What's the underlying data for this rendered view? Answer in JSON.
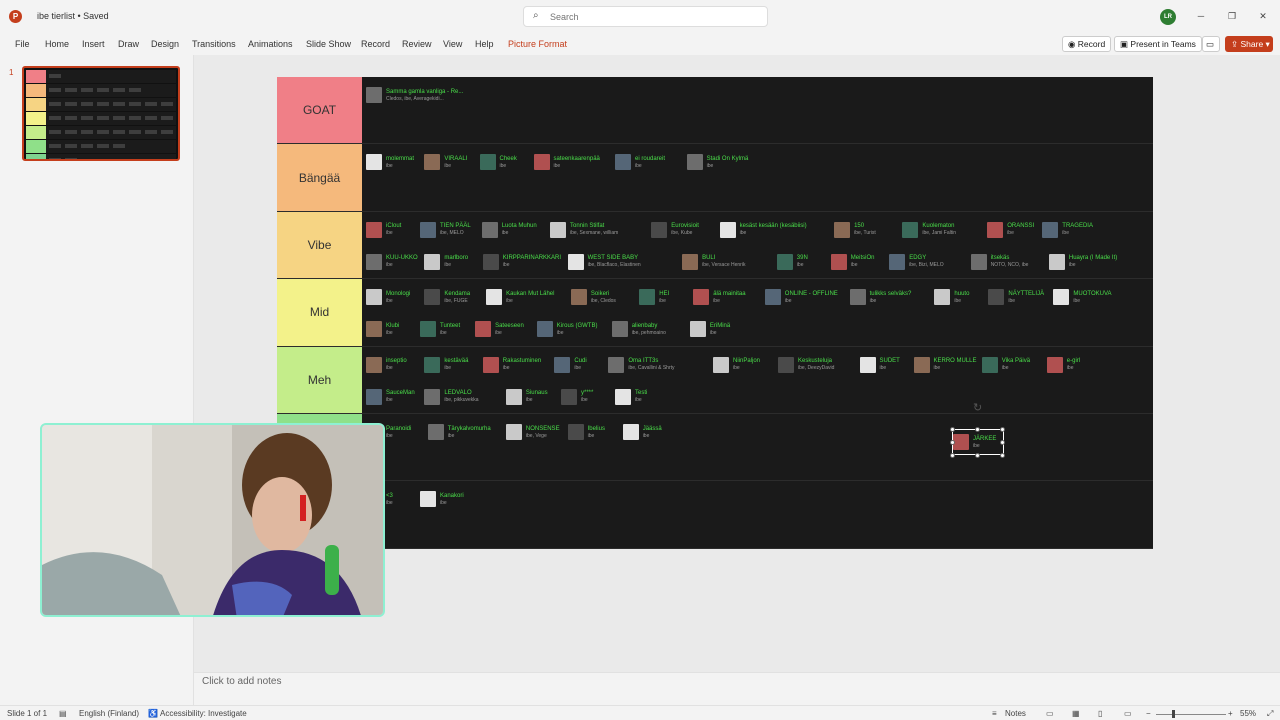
{
  "app": {
    "doc_title": "ibe tierlist • Saved",
    "logo": "P"
  },
  "search": {
    "placeholder": "Search"
  },
  "user": {
    "initials": "LR"
  },
  "menu": {
    "items": [
      "File",
      "Home",
      "Insert",
      "Draw",
      "Design",
      "Transitions",
      "Animations",
      "Slide Show",
      "Record",
      "Review",
      "View",
      "Help",
      "Picture Format"
    ]
  },
  "ribbon": {
    "record_label": "Record",
    "teams_label": "Present in Teams",
    "share_label": "Share"
  },
  "thumbnails": {
    "slide_number": "1"
  },
  "tierlist": {
    "tiers": [
      {
        "label": "GOAT",
        "color": "#f07f87",
        "items": [
          {
            "title": "Samma gamla vanliga - Re...",
            "artist": "Cledos, ibe, Averagekidi..."
          }
        ]
      },
      {
        "label": "Bängää",
        "color": "#f5b97c",
        "items": [
          {
            "title": "molemmat",
            "artist": "ibe"
          },
          {
            "title": "VIRAALI",
            "artist": "ibe"
          },
          {
            "title": "Cheek",
            "artist": "ibe"
          },
          {
            "title": "sateenkaarenpää",
            "artist": "ibe"
          },
          {
            "title": "ei roudareit",
            "artist": "ibe"
          },
          {
            "title": "Stadi On Kylmä",
            "artist": "ibe"
          }
        ]
      },
      {
        "label": "Vibe",
        "color": "#f6d483",
        "items": [
          {
            "title": "iClout",
            "artist": "ibe"
          },
          {
            "title": "TIEN PÄÄL",
            "artist": "ibe, MELO"
          },
          {
            "title": "Luota Muhun",
            "artist": "ibe"
          },
          {
            "title": "Tonnin Stilfat",
            "artist": "ibe, Sexmane, william"
          },
          {
            "title": "Eurovisioit",
            "artist": "ibe, Kube"
          },
          {
            "title": "kesäst kesään (kesäbiisi)",
            "artist": "ibe"
          },
          {
            "title": "150",
            "artist": "ibe, Turist"
          },
          {
            "title": "Kuolematon",
            "artist": "ibe, Jami Faltin"
          },
          {
            "title": "ORANSSI",
            "artist": "ibe"
          },
          {
            "title": "TRAGEDIA",
            "artist": "ibe"
          },
          {
            "title": "KUU-UKKO",
            "artist": "ibe"
          },
          {
            "title": "marlboro",
            "artist": "ibe"
          },
          {
            "title": "KIRPPARINARKKARI",
            "artist": "ibe"
          },
          {
            "title": "WEST SIDE BABY",
            "artist": "ibe, Blacflaco, Elastinen"
          },
          {
            "title": "BULI",
            "artist": "ibe, Versace Henrik"
          },
          {
            "title": "39N",
            "artist": "ibe"
          },
          {
            "title": "MeitsiOn",
            "artist": "ibe"
          },
          {
            "title": "EDGY",
            "artist": "ibe, Bizi, MELO"
          },
          {
            "title": "itsekäs",
            "artist": "NOTO, NCO, ibe"
          },
          {
            "title": "Huayra (I Made It)",
            "artist": "ibe"
          }
        ]
      },
      {
        "label": "Mid",
        "color": "#f3f28a",
        "items": [
          {
            "title": "Monologi",
            "artist": "ibe"
          },
          {
            "title": "Kendama",
            "artist": "ibe, FUGE"
          },
          {
            "title": "Kaukan Mut Lähel",
            "artist": "ibe"
          },
          {
            "title": "Soikeri",
            "artist": "ibe, Cledos"
          },
          {
            "title": "HEI",
            "artist": "ibe"
          },
          {
            "title": "älä mainitaa",
            "artist": "ibe"
          },
          {
            "title": "ONLINE - OFFLINE",
            "artist": "ibe"
          },
          {
            "title": "tulikks selväks?",
            "artist": "ibe"
          },
          {
            "title": "huuto",
            "artist": "ibe"
          },
          {
            "title": "NÄYTTELIJÄ",
            "artist": "ibe"
          },
          {
            "title": "MUOTOKUVA",
            "artist": "ibe"
          },
          {
            "title": "Klubi",
            "artist": "ibe"
          },
          {
            "title": "Tunteet",
            "artist": "ibe"
          },
          {
            "title": "Sateeseen",
            "artist": "ibe"
          },
          {
            "title": "Kirous (GWTB)",
            "artist": "ibe"
          },
          {
            "title": "alienbaby",
            "artist": "ibe, pehmoaino"
          },
          {
            "title": "EriMinä",
            "artist": "ibe"
          }
        ]
      },
      {
        "label": "Meh",
        "color": "#c4ed8a",
        "items": [
          {
            "title": "inseptio",
            "artist": "ibe"
          },
          {
            "title": "kestävää",
            "artist": "ibe"
          },
          {
            "title": "Rakastuminen",
            "artist": "ibe"
          },
          {
            "title": "Cudi",
            "artist": "ibe"
          },
          {
            "title": "Oma ITT3s",
            "artist": "ibe, Cavallini & Shrty"
          },
          {
            "title": "NiinPaljon",
            "artist": "ibe"
          },
          {
            "title": "Keskusteluja",
            "artist": "ibe, DeezyDavid"
          },
          {
            "title": "SUDET",
            "artist": "ibe"
          },
          {
            "title": "KERRO MULLE",
            "artist": "ibe"
          },
          {
            "title": "Vika Päivä",
            "artist": "ibe"
          },
          {
            "title": "e-girl",
            "artist": "ibe"
          },
          {
            "title": "SauceMan",
            "artist": "ibe"
          },
          {
            "title": "LEDVALO",
            "artist": "ibe, pikkuvekka"
          },
          {
            "title": "Siunaus",
            "artist": "ibe"
          },
          {
            "title": "y****",
            "artist": "ibe"
          },
          {
            "title": "Testi",
            "artist": "ibe"
          }
        ]
      },
      {
        "label": "",
        "color": "#8fe089",
        "items": [
          {
            "title": "Paranoidi",
            "artist": "ibe"
          },
          {
            "title": "Tärykalvomurha",
            "artist": "ibe"
          },
          {
            "title": "NONSENSE",
            "artist": "ibe, Vege"
          },
          {
            "title": "Ibelius",
            "artist": "ibe"
          },
          {
            "title": "Jäässä",
            "artist": "ibe"
          }
        ]
      },
      {
        "label": "",
        "color": "#7fd38f",
        "items": [
          {
            "title": "<3",
            "artist": "ibe"
          },
          {
            "title": "Kanakori",
            "artist": "ibe"
          }
        ]
      }
    ],
    "selected_item": {
      "title": "JÄRKEE",
      "artist": "ibe"
    }
  },
  "notes": {
    "placeholder": "Click to add notes"
  },
  "status": {
    "slide": "Slide 1 of 1",
    "language": "English (Finland)",
    "accessibility": "Accessibility: Investigate",
    "notes_label": "Notes",
    "zoom": "55%"
  }
}
